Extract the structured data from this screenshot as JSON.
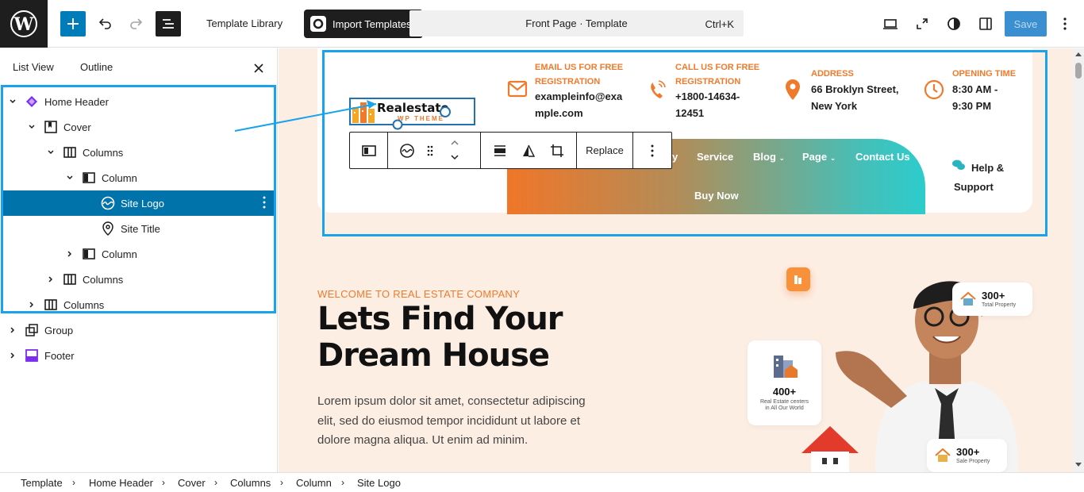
{
  "topbar": {
    "template_library": "Template Library",
    "import_templates": "Import Templates",
    "document_title": "Front Page · Template",
    "shortcut": "Ctrl+K",
    "save": "Save"
  },
  "sidebar": {
    "tabs": [
      "List View",
      "Outline"
    ],
    "tree": [
      {
        "label": "Home Header",
        "icon": "template-part-icon"
      },
      {
        "label": "Cover",
        "icon": "cover-icon"
      },
      {
        "label": "Columns",
        "icon": "columns-icon"
      },
      {
        "label": "Column",
        "icon": "column-icon"
      },
      {
        "label": "Site Logo",
        "icon": "site-logo-icon",
        "selected": true
      },
      {
        "label": "Site Title",
        "icon": "map-pin-icon"
      },
      {
        "label": "Column",
        "icon": "column-icon"
      },
      {
        "label": "Columns",
        "icon": "columns-icon"
      },
      {
        "label": "Columns",
        "icon": "columns-icon"
      },
      {
        "label": "Group",
        "icon": "group-icon"
      },
      {
        "label": "Footer",
        "icon": "footer-icon"
      }
    ]
  },
  "header": {
    "logo_text": "Realestate",
    "logo_sub": "WP THEME",
    "email": {
      "title_1": "EMAIL US FOR FREE",
      "title_2": "REGISTRATION",
      "value_1": "exampleinfo@exa",
      "value_2": "mple.com"
    },
    "call": {
      "title_1": "CALL US FOR FREE",
      "title_2": "REGISTRATION",
      "value_1": "+1800-14634-",
      "value_2": "12451"
    },
    "address": {
      "title": "ADDRESS",
      "value_1": "66 Broklyn Street,",
      "value_2": "New York"
    },
    "opening": {
      "title": "OPENING TIME",
      "value_1": "8:30 AM -",
      "value_2": "9:30 PM"
    },
    "nav": {
      "partial": "y",
      "service": "Service",
      "blog": "Blog",
      "page": "Page",
      "contact": "Contact Us",
      "buy": "Buy Now"
    },
    "help_1": "Help &",
    "help_2": "Support"
  },
  "toolbar": {
    "replace": "Replace"
  },
  "hero": {
    "welcome": "WELCOME TO REAL ESTATE COMPANY",
    "title_1": "Lets Find Your",
    "title_2": "Dream House",
    "body": "Lorem ipsum dolor sit amet, consectetur adipiscing elit, sed do eiusmod tempor incididunt ut labore et dolore magna aliqua. Ut enim ad minim."
  },
  "stats": [
    {
      "num": "300+",
      "label": "Total Property"
    },
    {
      "num": "400+",
      "label_1": "Real Estate centers",
      "label_2": "in All Our World"
    },
    {
      "num": "300+",
      "label": "Sale Property"
    }
  ],
  "breadcrumb": [
    "Template",
    "Home Header",
    "Cover",
    "Columns",
    "Column",
    "Site Logo"
  ],
  "colors": {
    "accent": "#007cba",
    "orange": "#f07a2c",
    "teal": "#2ccccc",
    "highlight": "#19a3ec"
  }
}
